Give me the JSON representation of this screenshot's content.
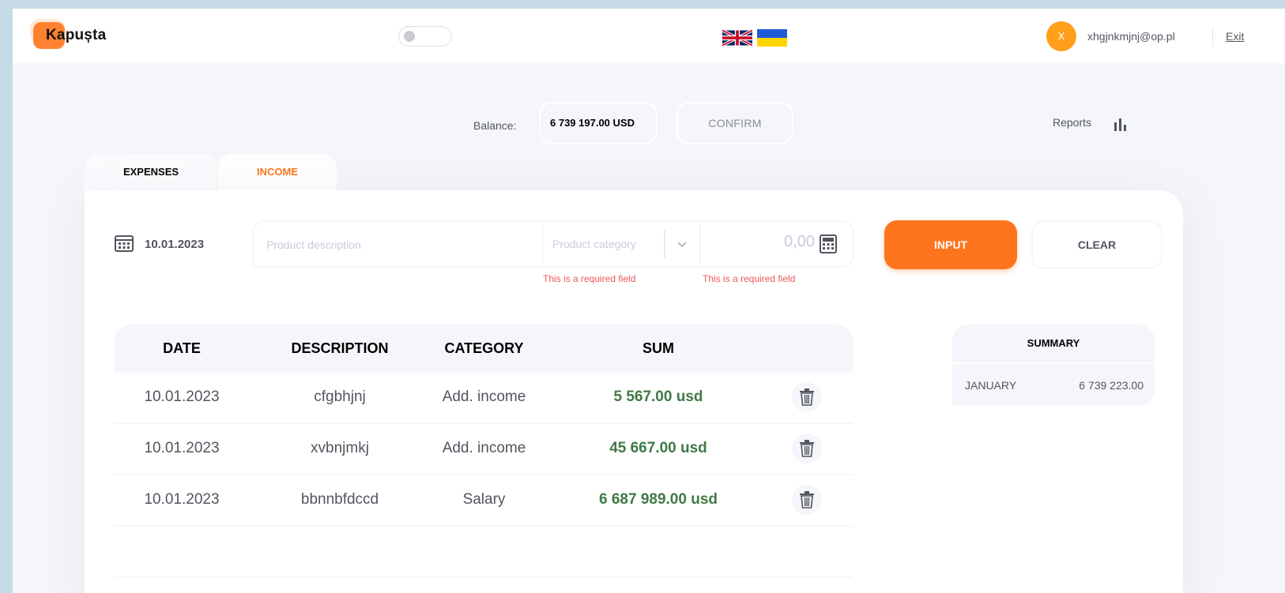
{
  "header": {
    "logo_text": "Kapușta",
    "user_initial": "X",
    "user_email": "xhgjnkmjnj@op.pl",
    "exit_label": "Exit",
    "languages": [
      "en-flag-icon",
      "ua-flag-icon"
    ]
  },
  "balance": {
    "label": "Balance:",
    "value": "6 739 197.00 USD",
    "confirm_label": "CONFIRM",
    "reports_label": "Reports"
  },
  "tabs": [
    {
      "label": "EXPENSES",
      "active": false
    },
    {
      "label": "INCOME",
      "active": true
    }
  ],
  "form": {
    "date": "10.01.2023",
    "description_placeholder": "Product description",
    "category_placeholder": "Product category",
    "amount_placeholder": "0,00",
    "error_category": "This is a required field",
    "error_amount": "This is a required field",
    "input_label": "INPUT",
    "clear_label": "CLEAR"
  },
  "table": {
    "headers": [
      "DATE",
      "DESCRIPTION",
      "CATEGORY",
      "SUM"
    ],
    "rows": [
      {
        "date": "10.01.2023",
        "description": "cfgbhjnj",
        "category": "Add. income",
        "sum": "5 567.00 usd"
      },
      {
        "date": "10.01.2023",
        "description": "xvbnjmkj",
        "category": "Add. income",
        "sum": "45 667.00 usd"
      },
      {
        "date": "10.01.2023",
        "description": "bbnnbfdccd",
        "category": "Salary",
        "sum": "6 687 989.00 usd"
      }
    ]
  },
  "summary": {
    "title": "SUMMARY",
    "rows": [
      {
        "month": "JANUARY",
        "value": "6 739 223.00"
      }
    ]
  },
  "colors": {
    "accent": "#ff751d",
    "income_green": "#407946",
    "error": "#eb5757",
    "frame": "#c6dbe5"
  }
}
